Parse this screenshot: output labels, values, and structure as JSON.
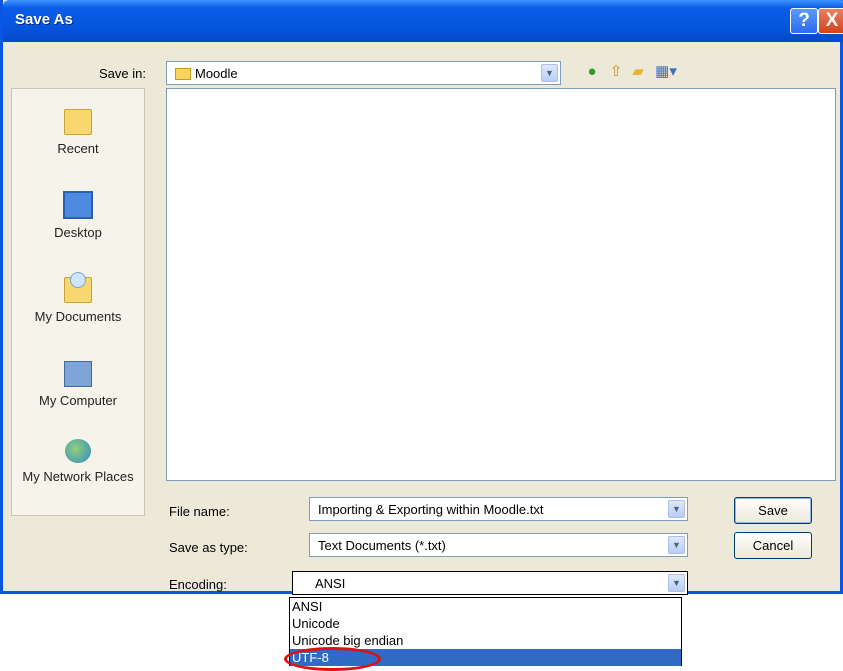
{
  "window": {
    "title": "Save As",
    "help_label": "?",
    "close_label": "X"
  },
  "toolbar": {
    "save_in_label": "Save in:",
    "save_in_value": "Moodle",
    "icons": [
      "back-icon",
      "up-folder-icon",
      "new-folder-icon",
      "views-menu-icon"
    ]
  },
  "places": [
    {
      "label": "Recent",
      "icon": "recent-folder-icon"
    },
    {
      "label": "Desktop",
      "icon": "desktop-icon"
    },
    {
      "label": "My Documents",
      "icon": "my-documents-icon"
    },
    {
      "label": "My Computer",
      "icon": "my-computer-icon"
    },
    {
      "label": "My Network Places",
      "icon": "network-places-icon"
    }
  ],
  "fields": {
    "file_name_label": "File name:",
    "file_name_value": "Importing & Exporting within Moodle.txt",
    "save_as_type_label": "Save as type:",
    "save_as_type_value": "Text Documents (*.txt)",
    "encoding_label": "Encoding:",
    "encoding_value": "ANSI"
  },
  "buttons": {
    "save": "Save",
    "cancel": "Cancel"
  },
  "encoding_options": [
    {
      "label": "ANSI",
      "selected": false
    },
    {
      "label": "Unicode",
      "selected": false
    },
    {
      "label": "Unicode big endian",
      "selected": false
    },
    {
      "label": "UTF-8",
      "selected": true
    }
  ],
  "colors": {
    "titlebar": "#0656e0",
    "selection": "#316ac5",
    "annotation_ring": "#e01010"
  }
}
